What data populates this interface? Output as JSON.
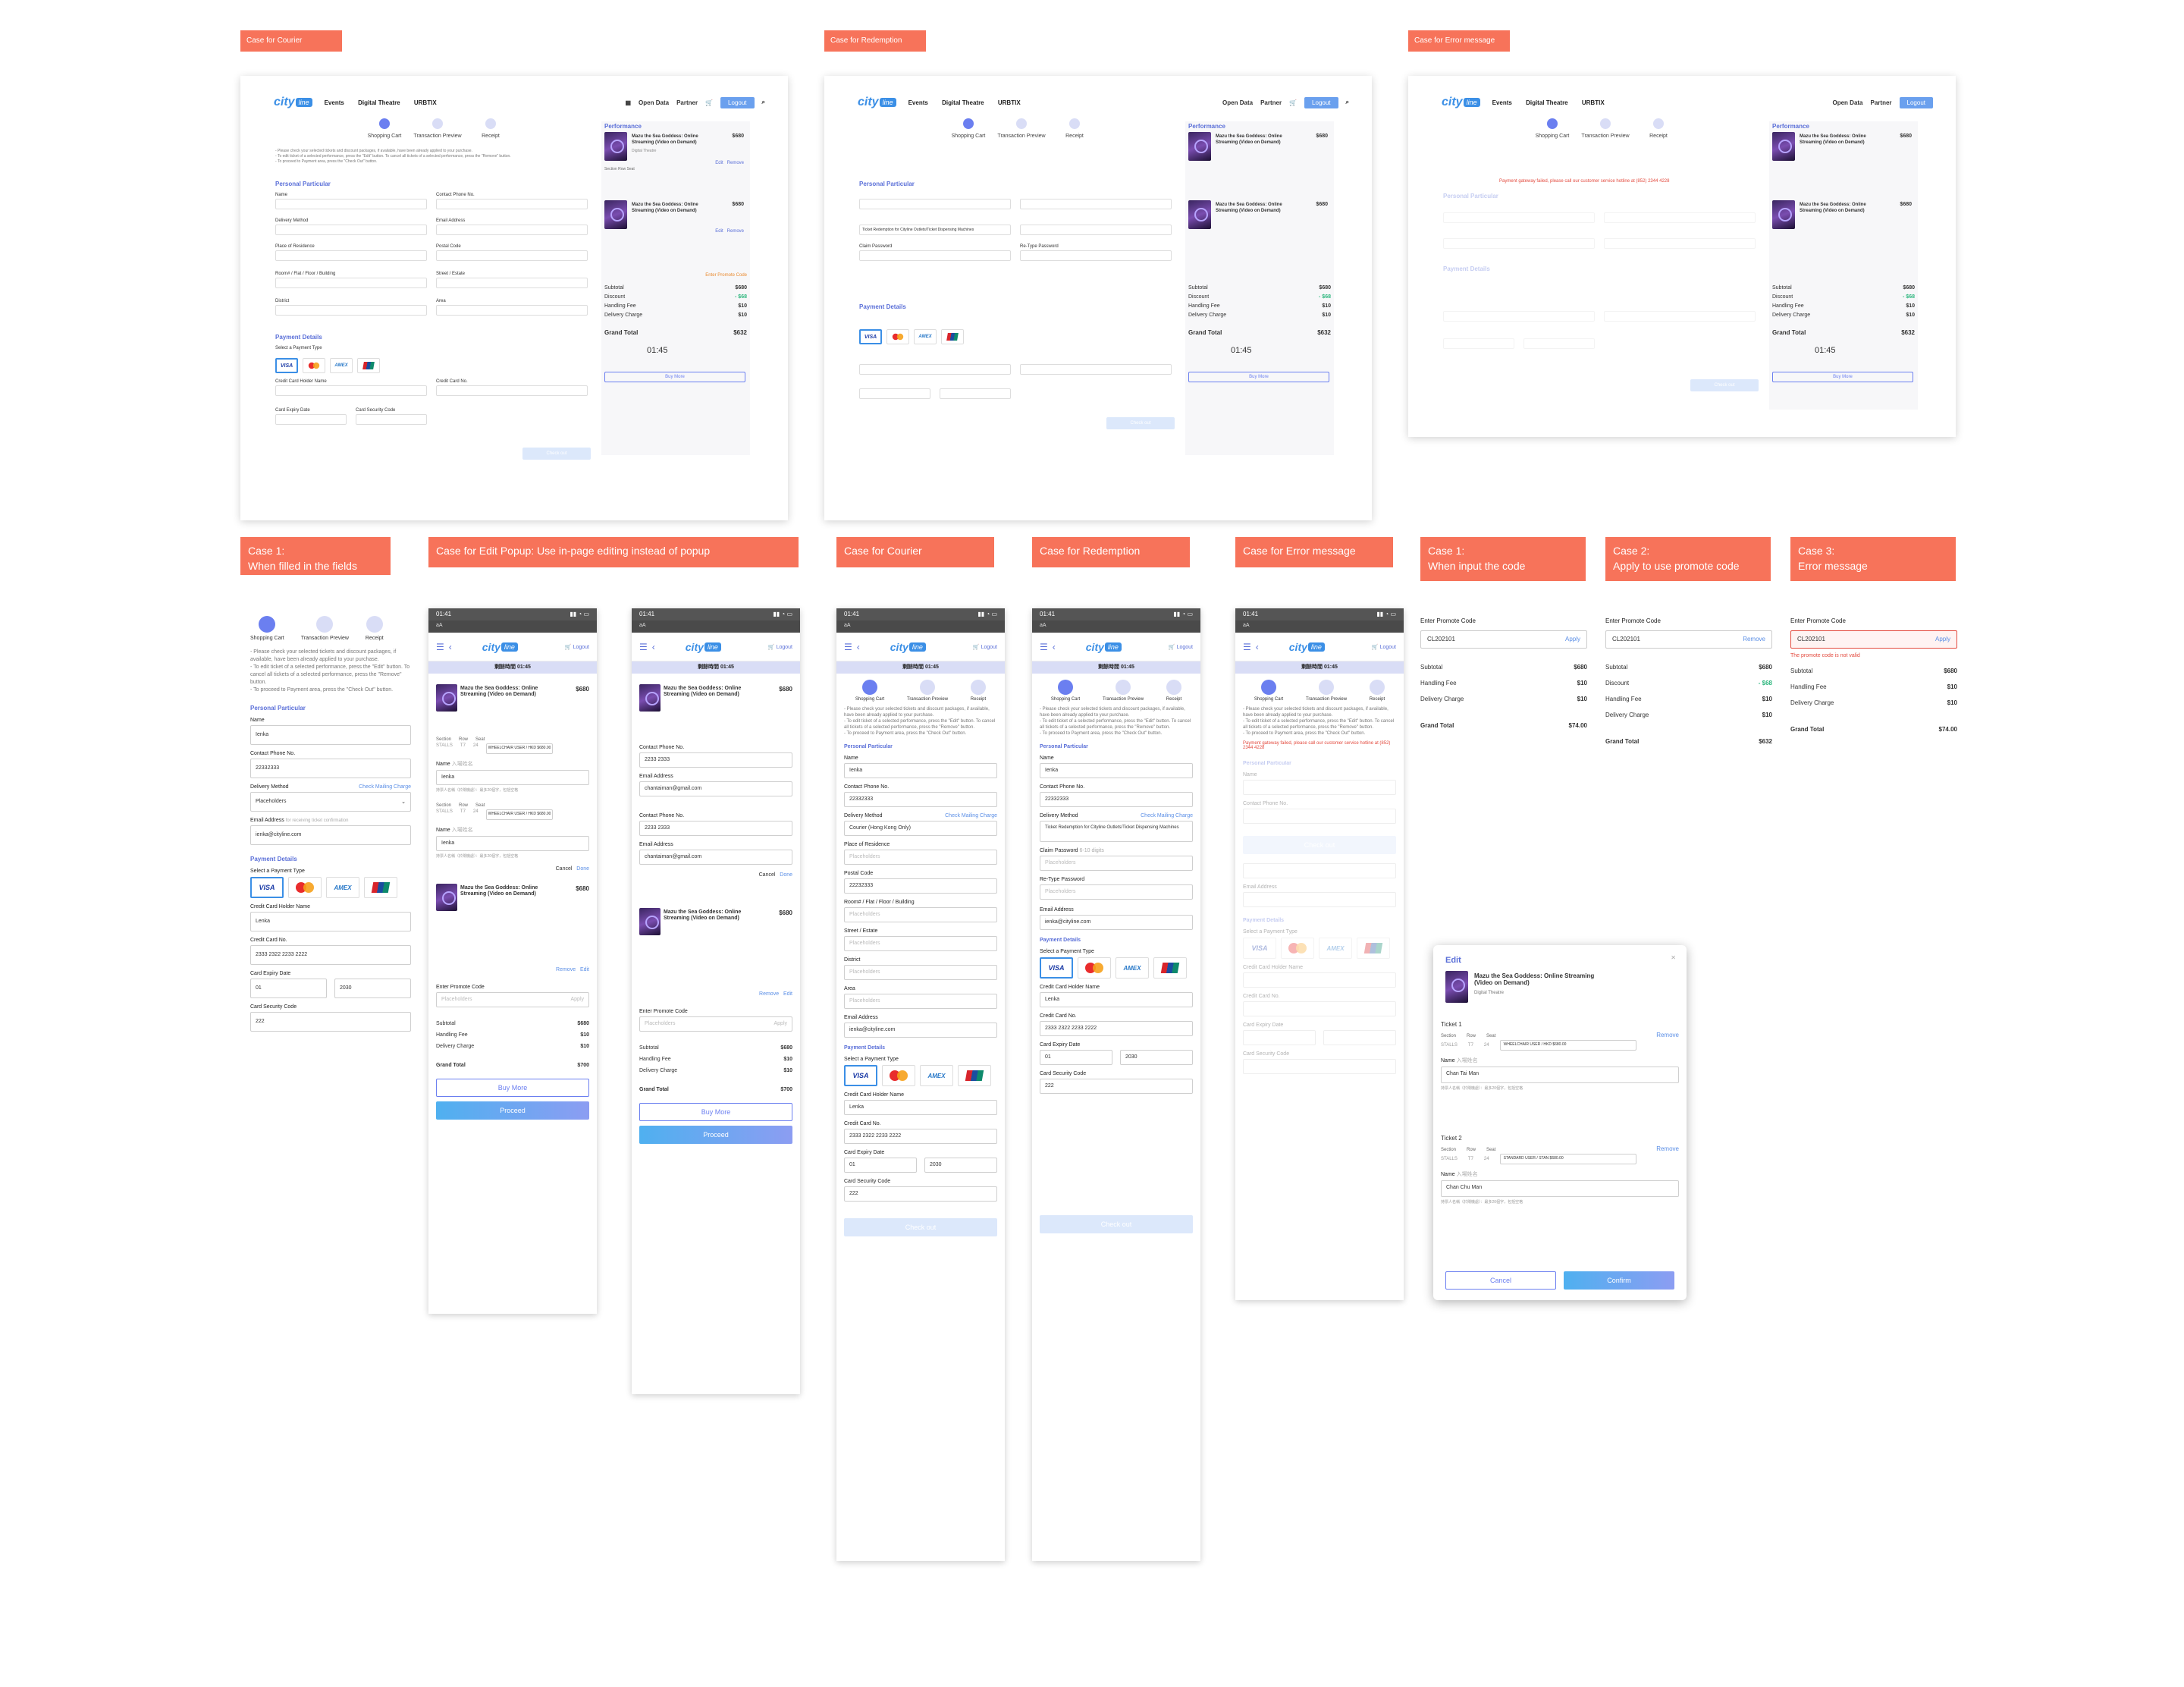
{
  "labels": {
    "top_courier": "Case for Courier",
    "top_redemption": "Case for  Redemption",
    "top_error": "Case for Error message",
    "case1_fields": "Case 1:\nWhen filled in the fields",
    "edit_popup": "Case for Edit Popup: Use  in-page editing instead of popup",
    "courier": "Case for Courier",
    "redemption": "Case for  Redemption",
    "error": "Case for Error message",
    "case1_code": "Case 1:\nWhen input the code",
    "case2_promo": "Case 2:\nApply to use promote code",
    "case3_error": "Case 3:\nError message"
  },
  "header": {
    "logo_city": "city",
    "logo_line": "line",
    "nav": [
      "Events",
      "Digital Theatre",
      "URBTIX"
    ],
    "right": [
      "Open Data",
      "Partner"
    ],
    "logout": "Logout"
  },
  "steps": [
    "Shopping Cart",
    "Transaction Preview",
    "Receipt"
  ],
  "intro": "- Please check your selected tickets and discount packages, if available, have been already applied to your purchase.\n- To edit ticket of a selected performance, press the \"Edit\" button. To cancel all tickets of a selected performance, press the \"Remove\" button.\n- To proceed to Payment area, press the \"Check Out\" button.",
  "sections": {
    "personal": "Personal Particular",
    "payment": "Payment Details",
    "performance": "Performance",
    "select_payment": "Select a Payment Type"
  },
  "fields": {
    "name": "Name",
    "contact": "Contact Phone No.",
    "delivery": "Delivery Method",
    "check_mailing": "Check Mailing Charge",
    "email": "Email Address",
    "email_hint": "for receiving ticket confirmation",
    "residence": "Place of Residence",
    "postal": "Postal Code",
    "room": "Room# / Flat / Floor / Building",
    "street": "Street / Estate",
    "district": "District",
    "area": "Area",
    "holder": "Credit Card Holder Name",
    "card_no": "Credit Card No.",
    "expiry": "Card Expiry Date",
    "security": "Card Security Code",
    "claim_pw": "Claim Password",
    "claim_hint": "6-10 digits",
    "retype_pw": "Re-Type Password",
    "placeholder": "Placeholders"
  },
  "values": {
    "name": "Ienka",
    "phone": "22332333",
    "delivery": "Placeholders",
    "delivery_courier": "Courier (Hong Kong Only)",
    "delivery_redemption": "Ticket Redemption for Cityline Outlets/Ticket Dispensing Machines",
    "email": "ienka@cityline.com",
    "holder": "Lenka",
    "card_no": "2333 2322 2233 2222",
    "expiry_month": "01",
    "expiry_year": "2030",
    "security": "222",
    "room": "22232333"
  },
  "ticket": {
    "title": "Mazu the Sea Goddess: Online Streaming (Video on Demand)",
    "venue": "Digital Theatre",
    "date": "2021/03/27 Sat 08:15 PM",
    "price": "$680",
    "quantity": "Quantity: 2",
    "seat_cols": [
      "Section",
      "Row",
      "Seat"
    ],
    "seat_row": [
      "STALLS",
      "T7",
      "24"
    ],
    "seat_type": "WHEELCHAIR USER / HKD $680.00",
    "edit": "Edit",
    "remove": "Remove",
    "view": "View",
    "see_details": "See Details"
  },
  "summary": {
    "promo_link": "Enter Promote Code",
    "subtotal_label": "Subtotal",
    "subtotal": "$680",
    "discount_label": "Discount",
    "discount": "- $68",
    "handling_label": "Handling Fee",
    "handling": "$10",
    "delivery_label": "Delivery Charge",
    "delivery": "$10",
    "grand_label": "Grand Total",
    "grand": "$632",
    "grand_alt": "$700",
    "grand_74": "$74.00",
    "timer_label": "剩餘時間",
    "timer": "01:45",
    "buy_more": "Buy More",
    "proceed": "Proceed",
    "checkout": "Check out"
  },
  "mobile": {
    "time": "01:41",
    "addr": "aA",
    "logout": "Logout",
    "timer": "剩餘時間   01:45",
    "cancel": "Cancel",
    "done": "Done",
    "chant_email": "chantaiman@gmail.com",
    "phone_alt": "2233 2333",
    "name_field": "Name",
    "name_hint": "入場姓名",
    "name_note": "持票人名稱（於閘機處）：最多20個字，包括空格"
  },
  "error": {
    "payment_failed": "Payment gateway failed, please call our customer service hotline at (852) 2344 4228",
    "promo_invalid": "The promote code is not valid"
  },
  "promo": {
    "label": "Enter Promote Code",
    "code1": "CL202101",
    "code2": "CL202101",
    "code3": "CL202101",
    "apply": "Apply",
    "remove": "Remove"
  },
  "popup": {
    "title": "Edit",
    "ticket1": "Ticket 1",
    "ticket2": "Ticket 2",
    "remove": "Remove",
    "ticket1_type": "WHEELCHAIR USER / HKD $680.00",
    "ticket2_type": "STANDARD USER / STAN $680.00",
    "name1": "Chan Tai Man",
    "name2": "Chan Chu Man",
    "cancel": "Cancel",
    "confirm": "Confirm"
  },
  "colors": {
    "label_bg": "#f7735a",
    "brand_blue": "#3b8fe6",
    "accent_purple": "#6b7ff0",
    "error_red": "#e34a3e",
    "discount_green": "#2cb67d"
  },
  "icons": [
    "hamburger-icon",
    "back-icon",
    "cart-icon",
    "search-icon",
    "close-icon",
    "chevron-down-icon",
    "check-icon"
  ]
}
